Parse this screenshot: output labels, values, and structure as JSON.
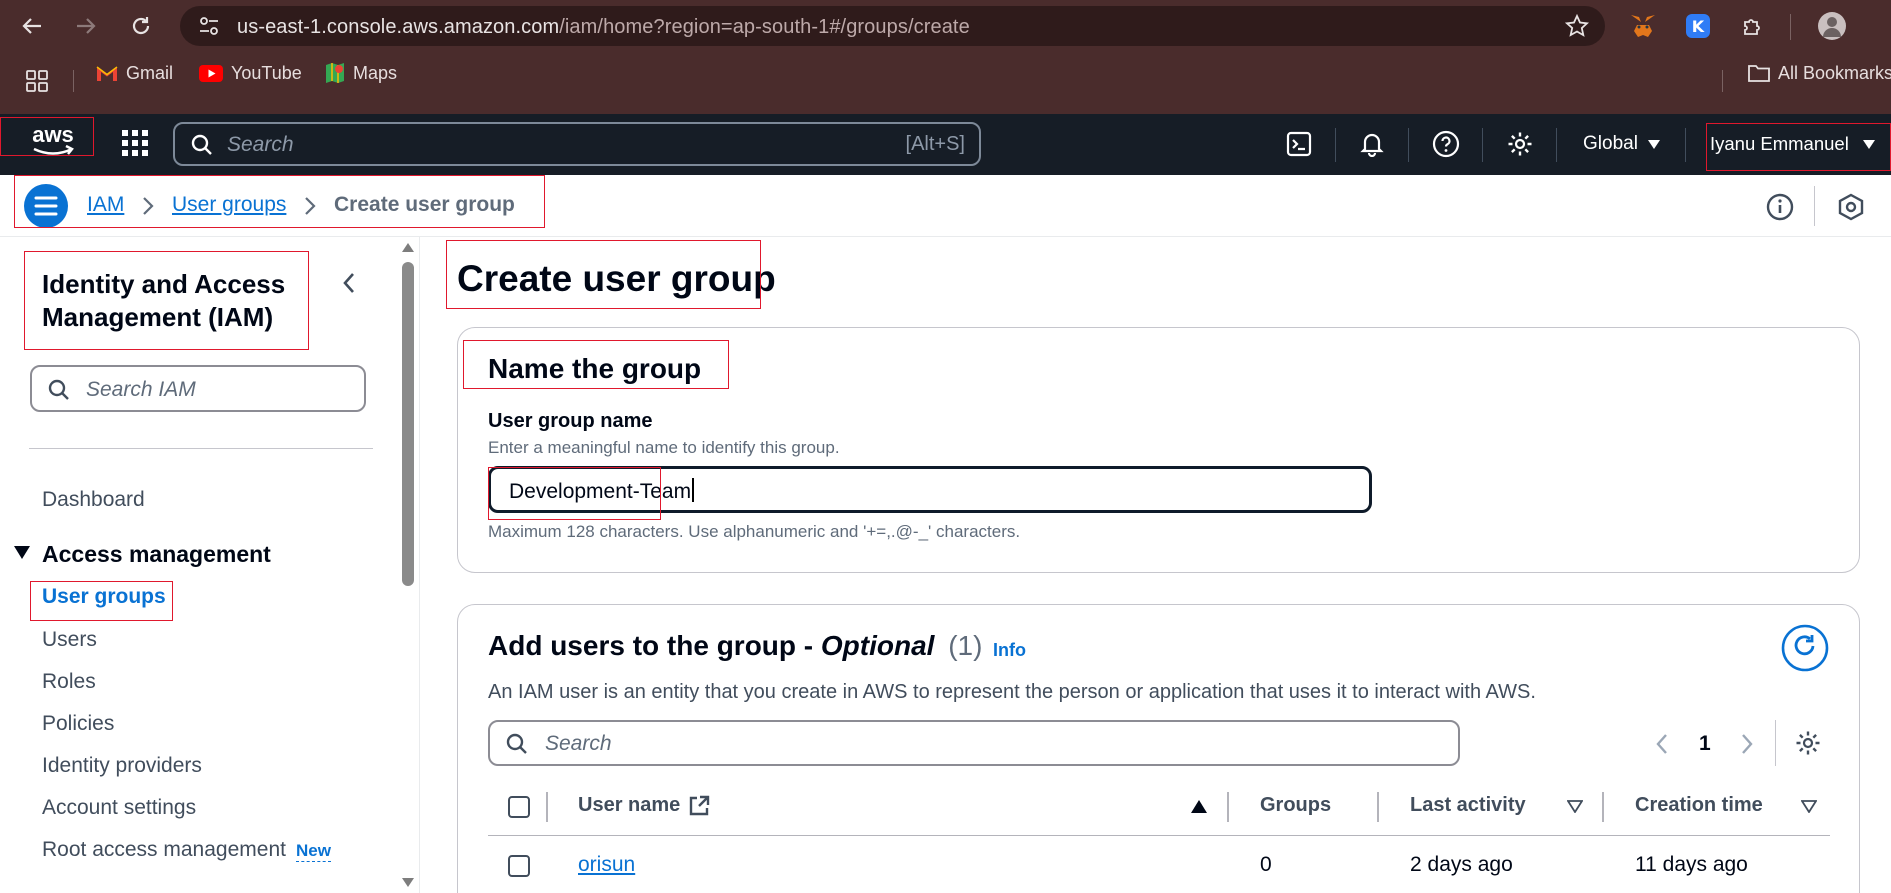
{
  "browser": {
    "url_host": "us-east-1.console.aws.amazon.com",
    "url_path": "/iam/home?region=ap-south-1#/groups/create",
    "bookmarks": [
      {
        "label": "Gmail",
        "icon": "gmail-icon"
      },
      {
        "label": "YouTube",
        "icon": "youtube-icon"
      },
      {
        "label": "Maps",
        "icon": "maps-icon"
      }
    ],
    "all_bookmarks": "All Bookmarks"
  },
  "aws_nav": {
    "logo": "aws",
    "search_placeholder": "Search",
    "search_shortcut": "[Alt+S]",
    "region": "Global",
    "account": "Iyanu Emmanuel"
  },
  "breadcrumb": {
    "items": [
      "IAM",
      "User groups"
    ],
    "current": "Create user group"
  },
  "sidebar": {
    "title_line1": "Identity and Access",
    "title_line2": "Management (IAM)",
    "search_placeholder": "Search IAM",
    "dashboard": "Dashboard",
    "section": "Access management",
    "items": [
      "User groups",
      "Users",
      "Roles",
      "Policies",
      "Identity providers",
      "Account settings",
      "Root access management"
    ],
    "new_badge": "New",
    "active_item": "User groups"
  },
  "main": {
    "title": "Create user group",
    "name_section": {
      "heading": "Name the group",
      "field_label": "User group name",
      "field_description": "Enter a meaningful name to identify this group.",
      "field_value": "Development-Team",
      "constraint": "Maximum 128 characters. Use alphanumeric and '+=,.@-_' characters."
    },
    "users_section": {
      "heading_prefix": "Add users to the group - ",
      "heading_optional": "Optional",
      "count": "(1)",
      "info_link": "Info",
      "description": "An IAM user is an entity that you create in AWS to represent the person or application that uses it to interact with AWS.",
      "search_placeholder": "Search",
      "page": "1",
      "columns": [
        "User name",
        "Groups",
        "Last activity",
        "Creation time"
      ],
      "rows": [
        {
          "user_name": "orisun",
          "groups": "0",
          "last_activity": "2 days ago",
          "creation_time": "11 days ago"
        }
      ]
    }
  },
  "colors": {
    "browser_chrome": "#4a2c2c",
    "aws_nav": "#161d26",
    "link": "#0972d3",
    "highlight_box": "#e0182d"
  }
}
